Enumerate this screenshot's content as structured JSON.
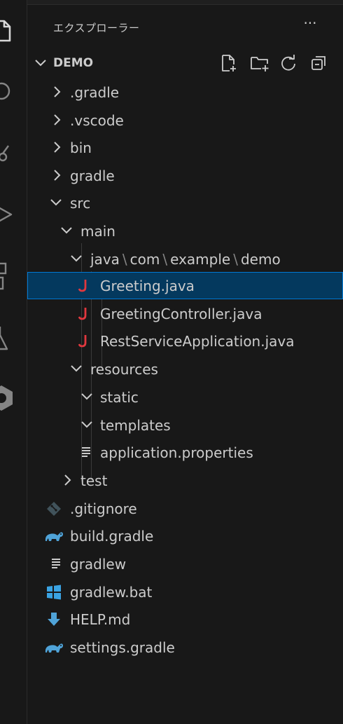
{
  "sidebar": {
    "title": "エクスプローラー",
    "more_label": "···",
    "section": {
      "title": "DEMO"
    }
  },
  "tree": {
    "gradle_dir": ".gradle",
    "vscode_dir": ".vscode",
    "bin_dir": "bin",
    "gradle2_dir": "gradle",
    "src_dir": "src",
    "main_dir": "main",
    "java_path": [
      "java",
      "com",
      "example",
      "demo"
    ],
    "path_sep": "\\",
    "greeting_file": "Greeting.java",
    "controller_file": "GreetingController.java",
    "app_file": "RestServiceApplication.java",
    "resources_dir": "resources",
    "static_dir": "static",
    "templates_dir": "templates",
    "props_file": "application.properties",
    "test_dir": "test",
    "gitignore_file": ".gitignore",
    "build_gradle_file": "build.gradle",
    "gradlew_file": "gradlew",
    "gradlew_bat_file": "gradlew.bat",
    "help_file": "HELP.md",
    "settings_gradle_file": "settings.gradle"
  },
  "colors": {
    "background": "#181818",
    "selected_bg": "#04395e",
    "selected_border": "#0078d4",
    "java_icon": "#e0383e",
    "gradle_icon": "#4fa3d8",
    "windows_icon": "#3aa3e3"
  },
  "icons": {
    "activity": [
      "explorer-icon",
      "search-icon",
      "source-control-icon",
      "run-debug-icon",
      "extensions-icon",
      "testing-icon",
      "remote-icon"
    ],
    "header": [
      "new-file-icon",
      "new-folder-icon",
      "refresh-icon",
      "collapse-all-icon"
    ]
  }
}
